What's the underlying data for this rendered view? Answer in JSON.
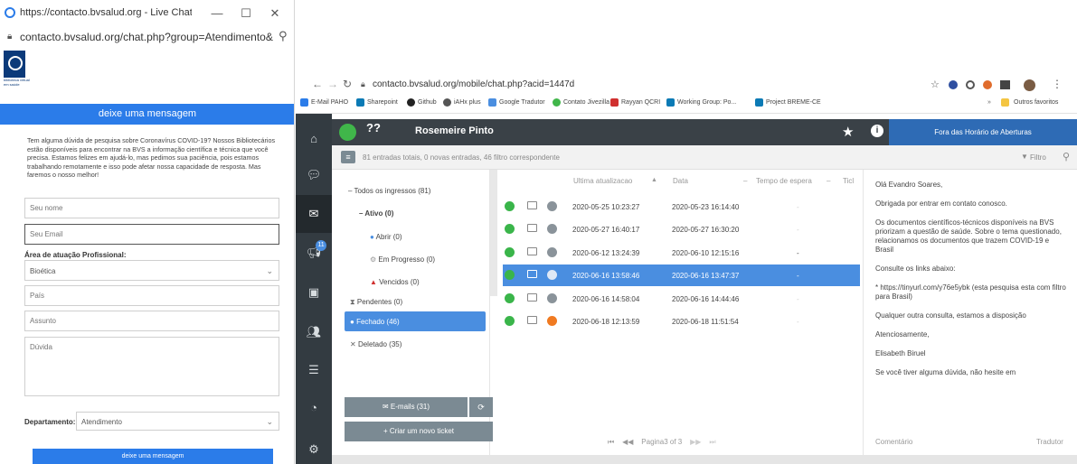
{
  "popup": {
    "title": "https://contacto.bvsalud.org - Live Chat - Goo...",
    "url": "contacto.bvsalud.org/chat.php?group=Atendimento&...",
    "logo_text": "biblioteca virtual em saúde",
    "header": "deixe uma mensagem",
    "intro": "Tem alguma dúvida de pesquisa sobre Coronavírus COVID-19? Nossos Bibliotecários estão disponíveis para encontrar na BVS a informação científica e técnica que você precisa. Estamos felizes em ajudá-lo, mas pedimos sua paciência, pois estamos trabalhando remotamente e isso pode afetar nossa capacidade de resposta. Mas faremos o nosso melhor!",
    "name_placeholder": "Seu nome",
    "email_placeholder": "Seu Email",
    "area_label": "Área de atuação Profissional:",
    "area_value": "Bioética",
    "country_placeholder": "País",
    "subject_placeholder": "Assunto",
    "question_placeholder": "Dúvida",
    "dept_label": "Departamento:",
    "dept_value": "Atendimento",
    "send_label": "deixe uma mensagem"
  },
  "browser": {
    "url": "contacto.bvsalud.org/mobile/chat.php?acid=1447d",
    "bookmarks": [
      "E-Mail PAHO",
      "Sharepoint",
      "Github",
      "iAHx plus",
      "Google Tradutor",
      "Contato Jivezilla",
      "Rayyan QCRI",
      "Working Group: Po...",
      "Project BREME-CE",
      "Outros favoritos"
    ]
  },
  "app": {
    "chat_label": "??",
    "operator_name": "Rosemeire Pinto",
    "status": "Fora das Horário de Aberturas",
    "entries": "81 entradas totais, 0 novas entradas, 46 filtro correspondente",
    "filter_label": "Filtro",
    "tree": {
      "all": "Todos os ingressos (81)",
      "active": "Ativo (0)",
      "open": "Abrir (0)",
      "in_progress": "Em Progresso (0)",
      "overdue": "Vencidos (0)",
      "pending": "Pendentes (0)",
      "closed": "Fechado (46)",
      "deleted": "Deletado (35)"
    },
    "emails_btn": "E-mails (31)",
    "new_ticket_btn": "+ Criar um novo ticket",
    "columns": [
      "Ultima atualizacao",
      "Data",
      "Tempo de espera",
      "Ticl"
    ],
    "rows": [
      {
        "updated": "2020-05-25 10:23:27",
        "date": "2020-05-23 16:14:40",
        "wait": "-"
      },
      {
        "updated": "2020-05-27 16:40:17",
        "date": "2020-05-27 16:30:20",
        "wait": "-"
      },
      {
        "updated": "2020-06-12 13:24:39",
        "date": "2020-06-10 12:15:16",
        "wait": "-"
      },
      {
        "updated": "2020-06-16 13:58:46",
        "date": "2020-06-16 13:47:37",
        "wait": "-"
      },
      {
        "updated": "2020-06-16 14:58:04",
        "date": "2020-06-16 14:44:46",
        "wait": "-"
      },
      {
        "updated": "2020-06-18 12:13:59",
        "date": "2020-06-18 11:51:54",
        "wait": "-"
      }
    ],
    "pager": "Pagina3 of 3",
    "reply": {
      "greeting": "Olá Evandro Soares,",
      "thanks": "Obrigada por entrar em contato conosco.",
      "docs": "Os documentos científicos-técnicos disponíveis na BVS priorizam a questão de saúde. Sobre o tema questionado, relacionamos os documentos que trazem COVID-19 e Brasil",
      "links_intro": "Consulte os links abaixo:",
      "link": "* https://tinyurl.com/y76e5ybk  (esta pesquisa esta com filtro para Brasil)",
      "other": "Qualquer outra consulta, estamos a disposição",
      "regards": "Atenciosamente,",
      "signature": "Elisabeth Biruel",
      "last_line": "Se você tiver alguma dúvida, não hesite em"
    },
    "comment_label": "Comentário",
    "translator_label": "Tradutor"
  },
  "colors": {
    "accent": "#2b7ce9",
    "sidebar": "#333b41",
    "selected_row": "#4a8ee0",
    "success": "#3ab54a"
  }
}
